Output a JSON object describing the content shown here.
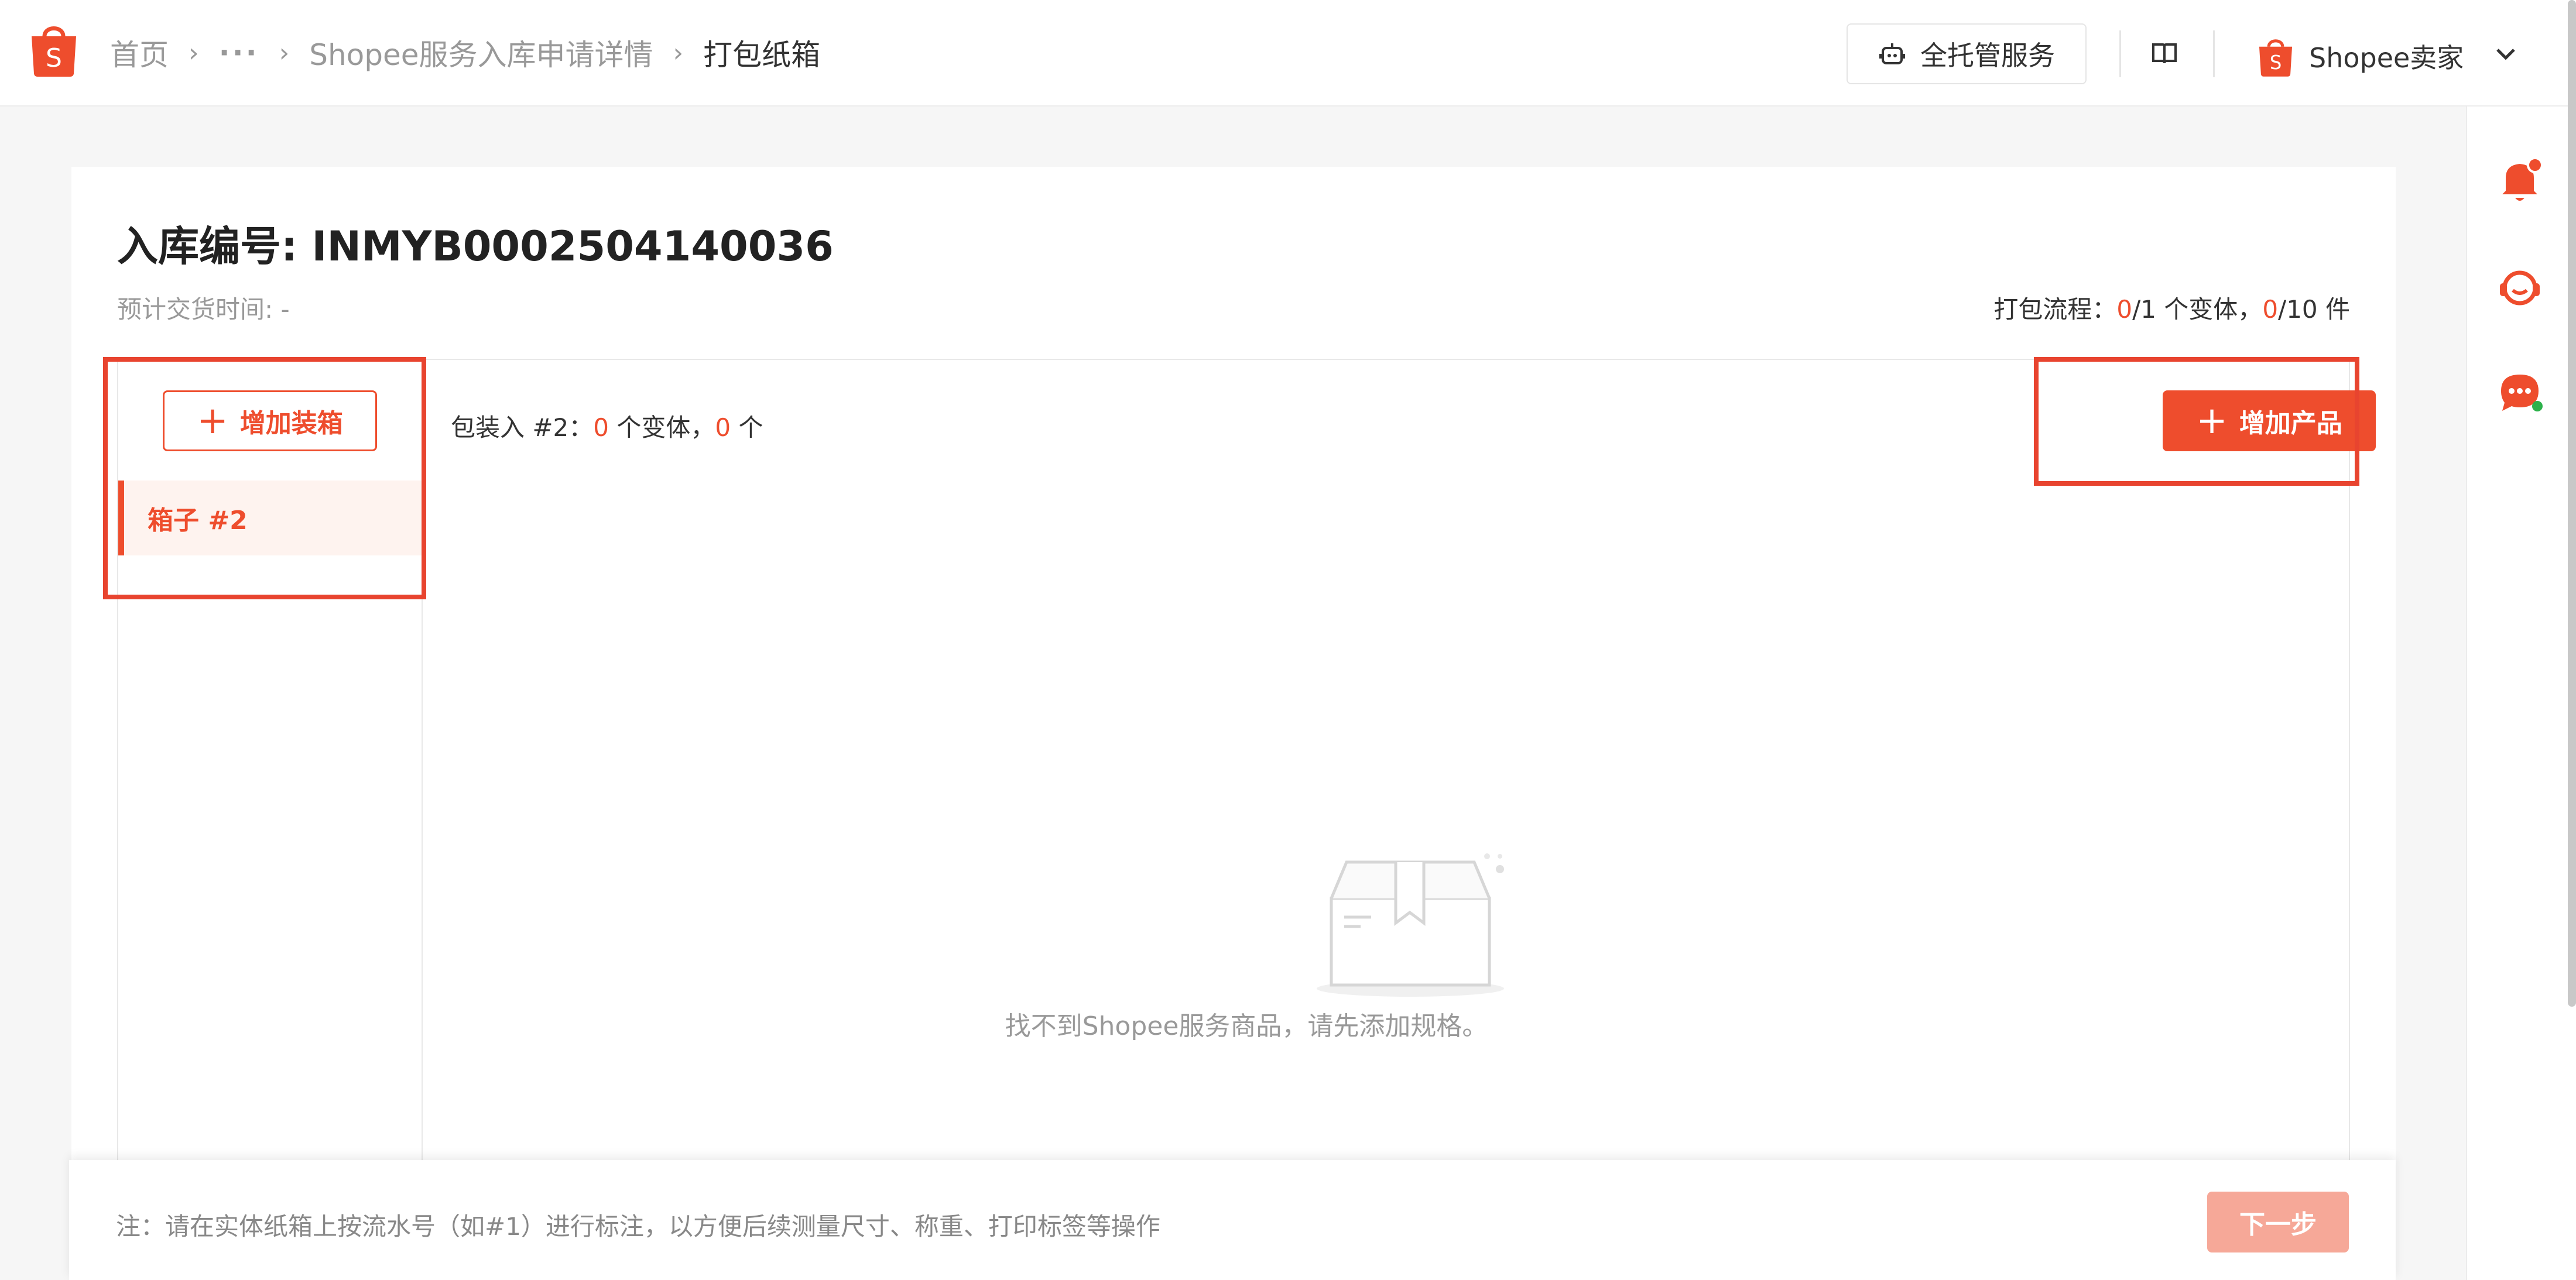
{
  "header": {
    "breadcrumb": {
      "home": "首页",
      "ellipsis": "···",
      "parent": "Shopee服务入库申请详情",
      "current": "打包纸箱"
    },
    "managed_service_label": "全托管服务",
    "seller_label": "Shopee卖家",
    "logo_letter": "S"
  },
  "page": {
    "title": "入库编号: INMYB0002504140036",
    "expected_time": "预计交货时间: -",
    "progress": {
      "label": "打包流程：",
      "variants_done": "0",
      "variants_sep": "/1 个变体，",
      "items_done": "0",
      "items_sep": "/10 件"
    }
  },
  "boxes": {
    "add_box_label": "增加装箱",
    "items": [
      {
        "label": "箱子 #2"
      }
    ]
  },
  "content": {
    "pack_label": "包装入 #2：",
    "variant_count": "0",
    "variant_unit": " 个变体，",
    "item_count": "0",
    "item_unit": " 个",
    "add_product_label": "增加产品",
    "empty_message": "找不到Shopee服务商品，请先添加规格。"
  },
  "footer": {
    "note": "注：请在实体纸箱上按流水号（如#1）进行标注，以方便后续测量尺寸、称重、打印标签等操作",
    "next_label": "下一步"
  },
  "colors": {
    "accent": "#ee4d2d",
    "disabled_accent": "#f6a898",
    "highlight": "#e8442f"
  }
}
